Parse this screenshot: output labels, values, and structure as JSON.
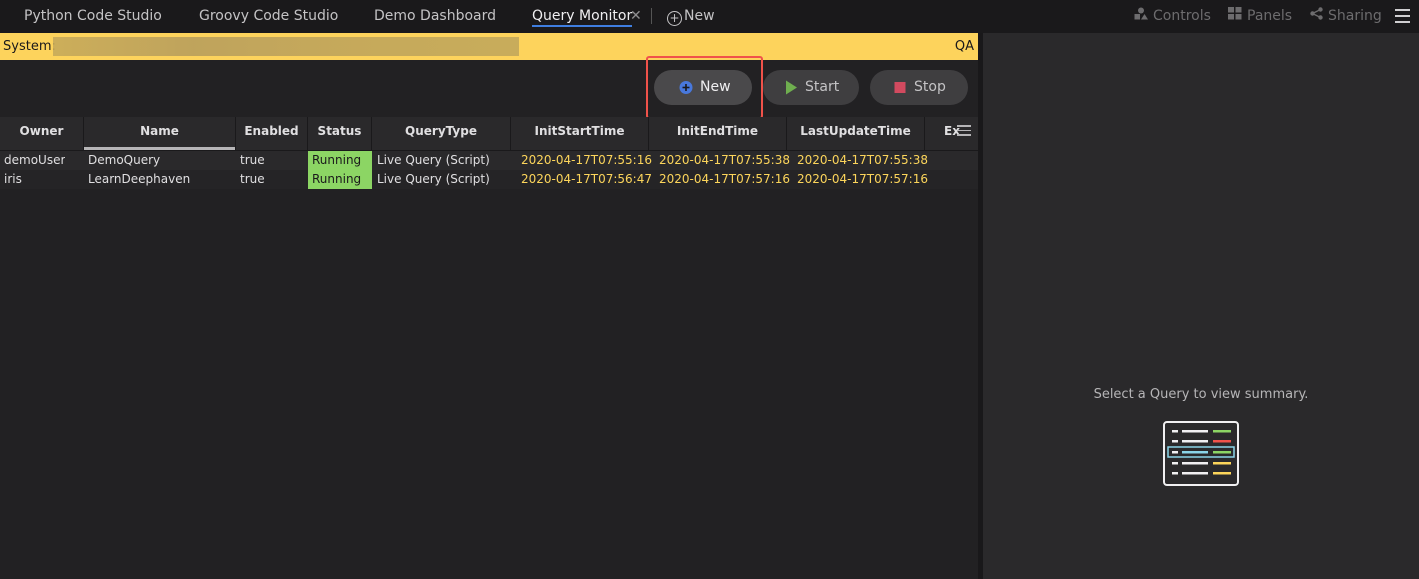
{
  "tabs": [
    {
      "label": "Python Code Studio"
    },
    {
      "label": "Groovy Code Studio"
    },
    {
      "label": "Demo Dashboard"
    },
    {
      "label": "Query Monitor"
    }
  ],
  "new_tab_label": "New",
  "top_right": {
    "controls": "Controls",
    "panels": "Panels",
    "sharing": "Sharing"
  },
  "system_bar": {
    "label": "System:",
    "env": "QA",
    "color": "#fdd35c"
  },
  "toolbar": {
    "new_label": "New",
    "start_label": "Start",
    "stop_label": "Stop"
  },
  "table": {
    "columns": [
      "Owner",
      "Name",
      "Enabled",
      "Status",
      "QueryType",
      "InitStartTime",
      "InitEndTime",
      "LastUpdateTime",
      "Ex"
    ],
    "rows": [
      {
        "owner": "demoUser",
        "name": "DemoQuery",
        "enabled": "true",
        "status": "Running",
        "query_type": "Live Query (Script)",
        "init_start": "2020-04-17T07:55:16",
        "init_end": "2020-04-17T07:55:38",
        "last_update": "2020-04-17T07:55:38"
      },
      {
        "owner": "iris",
        "name": "LearnDeephaven",
        "enabled": "true",
        "status": "Running",
        "query_type": "Live Query (Script)",
        "init_start": "2020-04-17T07:56:47",
        "init_end": "2020-04-17T07:57:16",
        "last_update": "2020-04-17T07:57:16"
      }
    ]
  },
  "summary": {
    "empty_text": "Select a Query to view summary."
  },
  "colors": {
    "running": "#8cd564",
    "time_text": "#fcd55b",
    "highlight": "#f0524a",
    "accent": "#3f7ee0"
  }
}
